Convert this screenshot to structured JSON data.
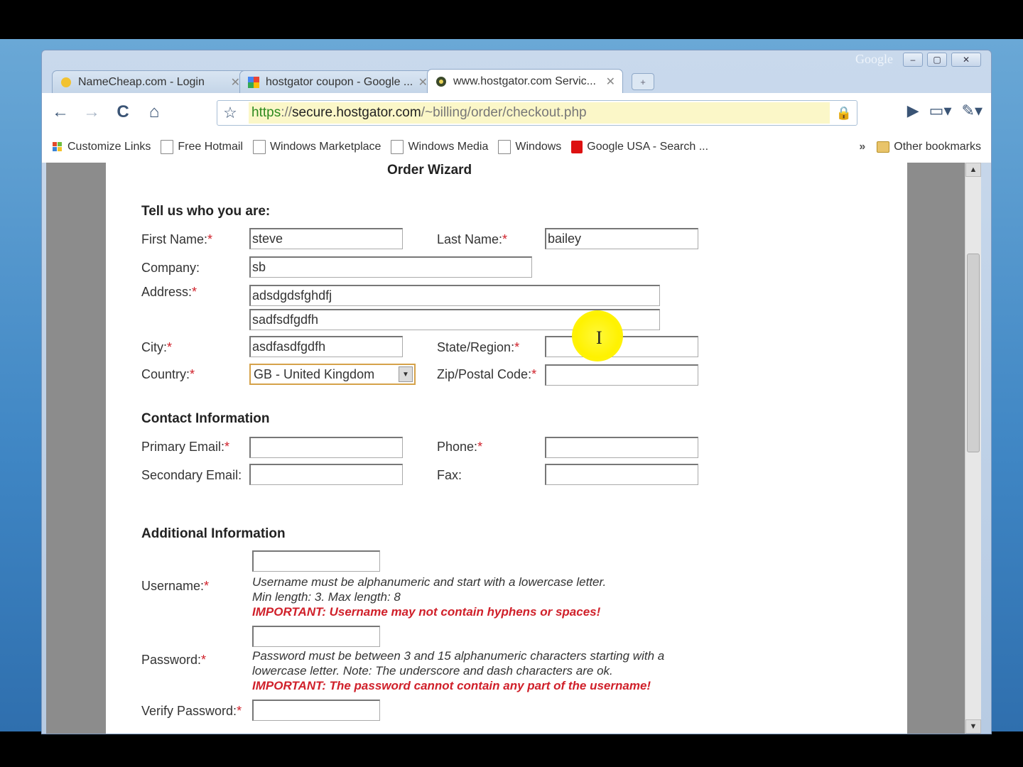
{
  "browser": {
    "brand": "Google",
    "caption_buttons": [
      "–",
      "▢",
      "✕"
    ],
    "tabs": [
      {
        "title": "NameCheap.com - Login",
        "close": "✕"
      },
      {
        "title": "hostgator coupon - Google ...",
        "close": "✕"
      },
      {
        "title": "www.hostgator.com Servic...",
        "close": "✕",
        "active": true
      }
    ],
    "new_tab": "+",
    "url": {
      "scheme": "https",
      "sep": "://",
      "host": "secure.hostgator.com",
      "path": "/~billing/order/checkout.php"
    },
    "nav": {
      "back": "←",
      "forward": "→",
      "reload": "C",
      "home": "⌂",
      "star": "☆"
    },
    "tool_right": {
      "play": "▶",
      "page": "▭▾",
      "wrench": "✎▾"
    },
    "bookmarks": [
      {
        "label": "Customize Links",
        "icon": "windows-flag-icon"
      },
      {
        "label": "Free Hotmail",
        "icon": "page-icon"
      },
      {
        "label": "Windows Marketplace",
        "icon": "page-icon"
      },
      {
        "label": "Windows Media",
        "icon": "page-icon"
      },
      {
        "label": "Windows",
        "icon": "page-icon"
      },
      {
        "label": "Google USA - Search ...",
        "icon": "google-icon"
      }
    ],
    "bookmarks_more": "»",
    "other_bookmarks": "Other bookmarks"
  },
  "form": {
    "title": "Order Wizard",
    "section_who": "Tell us who you are:",
    "first_name_label": "First Name:",
    "first_name_value": "steve",
    "last_name_label": "Last Name:",
    "last_name_value": "bailey",
    "company_label": "Company:",
    "company_value": "sb",
    "address_label": "Address:",
    "address1_value": "adsdgdsfghdfj",
    "address2_value": "sadfsdfgdfh",
    "city_label": "City:",
    "city_value": "asdfasdfgdfh",
    "state_label": "State/Region:",
    "state_value": "",
    "country_label": "Country:",
    "country_value": "GB - United Kingdom",
    "zip_label": "Zip/Postal Code:",
    "zip_value": "",
    "section_contact": "Contact Information",
    "primary_email_label": "Primary Email:",
    "phone_label": "Phone:",
    "secondary_email_label": "Secondary Email:",
    "fax_label": "Fax:",
    "section_additional": "Additional Information",
    "username_label": "Username:",
    "username_hint1": "Username must be alphanumeric and start with a lowercase letter.",
    "username_hint2": "Min length: 3. Max length: 8",
    "username_warn": "IMPORTANT: Username may not contain hyphens or spaces!",
    "password_label": "Password:",
    "password_hint1": "Password must be between 3 and 15 alphanumeric characters starting with a",
    "password_hint2": "lowercase letter. Note: The underscore and dash characters are ok.",
    "password_warn": "IMPORTANT: The password cannot contain any part of the username!",
    "verify_password_label": "Verify Password:",
    "required_mark": "*"
  },
  "colors": {
    "required": "#d0202a",
    "url_bg": "#fbf7c8",
    "https": "#2d8a1f",
    "highlight": "#fff200"
  }
}
